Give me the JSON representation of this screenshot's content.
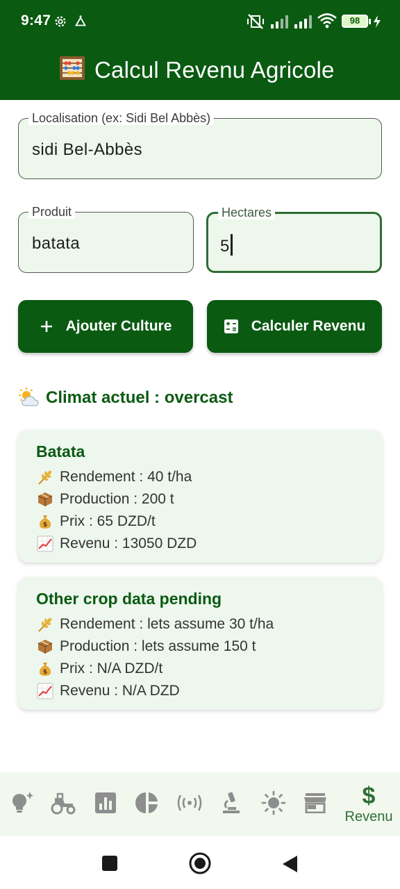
{
  "status": {
    "time": "9:47",
    "battery": "98"
  },
  "app": {
    "title": "Calcul Revenu Agricole",
    "title_icon": "abacus-icon"
  },
  "form": {
    "location": {
      "label": "Localisation (ex: Sidi Bel Abbès)",
      "value": "sidi Bel-Abbès"
    },
    "product": {
      "label": "Produit",
      "value": "batata"
    },
    "hectares": {
      "label": "Hectares",
      "value": "5"
    }
  },
  "buttons": {
    "add": "Ajouter Culture",
    "calc": "Calculer Revenu"
  },
  "climate": {
    "text": "Climat actuel : overcast",
    "icon": "sun-behind-cloud-icon"
  },
  "cards": [
    {
      "title": "Batata",
      "rendement": "Rendement : 40 t/ha",
      "production": "Production : 200 t",
      "prix": "Prix : 65 DZD/t",
      "revenu": "Revenu : 13050 DZD"
    },
    {
      "title": "Other crop data pending",
      "rendement": "Rendement : lets assume 30 t/ha",
      "production": "Production : lets assume 150 t",
      "prix": "Prix : N/A DZD/t",
      "revenu": "Revenu : N/A DZD"
    }
  ],
  "nav": {
    "items": [
      "lightbulb-icon",
      "tractor-icon",
      "bar-chart-icon",
      "pie-chart-icon",
      "broadcast-icon",
      "microscope-icon",
      "sun-icon",
      "store-icon",
      "dollar-icon"
    ],
    "active_label": "Revenu",
    "active_symbol": "$"
  },
  "colors": {
    "primary": "#0b5a12",
    "card_bg": "#eef7ee",
    "field_bg": "#edf7ec",
    "nav_bg": "#f2f8ee"
  }
}
